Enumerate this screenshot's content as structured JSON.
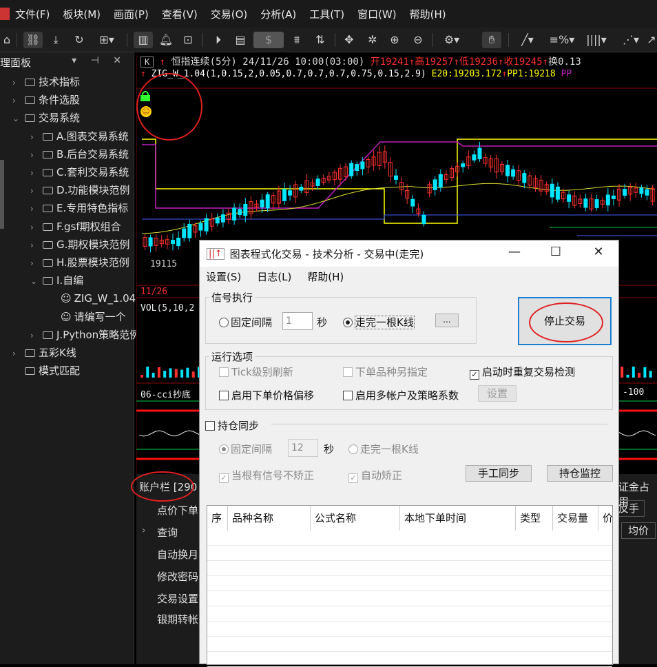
{
  "menubar": {
    "items": [
      "文件(F)",
      "板块(M)",
      "画面(P)",
      "查看(V)",
      "交易(O)",
      "分析(A)",
      "工具(T)",
      "窗口(W)",
      "帮助(H)"
    ]
  },
  "toolbar": {
    "icons": [
      "home-icon",
      "link-icon",
      "download-icon",
      "refresh-icon",
      "grid-icon",
      "candlestick-icon",
      "bell-icon",
      "chart-icon",
      "play-icon",
      "document-icon",
      "dollar-icon",
      "filter-icon",
      "sort-icon",
      "move-icon",
      "crosshair-icon",
      "zoom-in-icon",
      "zoom-out-icon",
      "settings-icon",
      "hand-icon",
      "line-draw-icon",
      "percent-icon",
      "bars-icon",
      "fan-icon",
      "trend-icon"
    ],
    "dollar_label": "$"
  },
  "left_panel": {
    "title": "理面板",
    "controls": "▾ ⊣ ✕",
    "tree": [
      {
        "label": "技术指标",
        "level": 1,
        "toggle": "›"
      },
      {
        "label": "条件选股",
        "level": 1,
        "toggle": "›"
      },
      {
        "label": "交易系统",
        "level": 1,
        "toggle": "⌄"
      },
      {
        "label": "A.图表交易系统",
        "level": 2,
        "toggle": "›"
      },
      {
        "label": "B.后台交易系统",
        "level": 2,
        "toggle": "›"
      },
      {
        "label": "C.套利交易系统",
        "level": 2,
        "toggle": "›"
      },
      {
        "label": "D.功能模块范例",
        "level": 2,
        "toggle": "›"
      },
      {
        "label": "E.专用特色指标",
        "level": 2,
        "toggle": "›"
      },
      {
        "label": "F.gsf期权组合",
        "level": 2,
        "toggle": "›"
      },
      {
        "label": "G.期权模块范例",
        "level": 2,
        "toggle": "›"
      },
      {
        "label": "H.股票模块范例",
        "level": 2,
        "toggle": "›"
      },
      {
        "label": "I.自编",
        "level": 2,
        "toggle": "⌄"
      },
      {
        "label": "ZIG_W_1.04",
        "level": 3,
        "toggle": "",
        "smile": true
      },
      {
        "label": "请编写一个",
        "level": 3,
        "toggle": "",
        "smile": true
      },
      {
        "label": "J.Python策略范例",
        "level": 2,
        "toggle": "›"
      },
      {
        "label": "五彩K线",
        "level": 1,
        "toggle": "›"
      },
      {
        "label": "模式匹配",
        "level": 1,
        "toggle": ""
      }
    ]
  },
  "chart": {
    "k_badge": "K",
    "title": "恒指连续(5分) 24/11/26 10:00(03:00)",
    "open": "开19241",
    "high": "高19257",
    "low": "低19236",
    "close": "收19245",
    "turnover": "换0.13",
    "formula": "ZIG_W_1.04(1,0.15,2,0.05,0.7,0.7,0.7,0.75,0.15,2.9)",
    "e20": "E20:19203.172",
    "pp1": "PP1:19218",
    "pp_more": "PP",
    "price_label": "19115",
    "date_label": "11/26",
    "vol_label": "VOL(5,10,2",
    "cci_label": "06-cci抄底",
    "cci_right": "-100",
    "lock_icon": "lock-icon",
    "smile_icon": "smiley-icon",
    "colors": {
      "up": "#ff3030",
      "down": "#00e5ff",
      "ma": "#e0e030",
      "zig_purple": "#c020c0",
      "zig_yellow": "#ffff00",
      "blue": "#4060ff",
      "green": "#00cc44"
    }
  },
  "account_bar": {
    "title": "账户栏 [290",
    "items": [
      "点价下单",
      "查询",
      "自动换月",
      "修改密码",
      "交易设置",
      "银期转帐"
    ],
    "right_label": "证金占用",
    "right_btn1": "反手",
    "right_btn2": "均价"
  },
  "dialog": {
    "title": "图表程式化交易 - 技术分析 - 交易中(走完)",
    "menu": [
      "设置(S)",
      "日志(L)",
      "帮助(H)"
    ],
    "signal_group": "信号执行",
    "fixed_interval": "固定间隔",
    "interval_value": "1",
    "seconds": "秒",
    "bar_complete": "走完一根K线",
    "ellipsis": "...",
    "stop_button": "停止交易",
    "run_options": "运行选项",
    "tick_refresh": "Tick级别刷新",
    "order_product": "下单品种另指定",
    "restart_check": "启动时重复交易检测",
    "price_offset": "启用下单价格偏移",
    "multi_account": "启用多帐户及策略系数",
    "settings_btn": "设置",
    "position_sync": "持仓同步",
    "sync_fixed": "固定间隔",
    "sync_value": "12",
    "sync_seconds": "秒",
    "sync_bar": "走完一根K线",
    "no_correct": "当根有信号不矫正",
    "auto_correct": "自动矫正",
    "manual_sync": "手工同步",
    "position_monitor": "持仓监控",
    "table_headers": [
      "序",
      "品种名称",
      "公式名称",
      "本地下单时间",
      "类型",
      "交易量",
      "价"
    ]
  }
}
